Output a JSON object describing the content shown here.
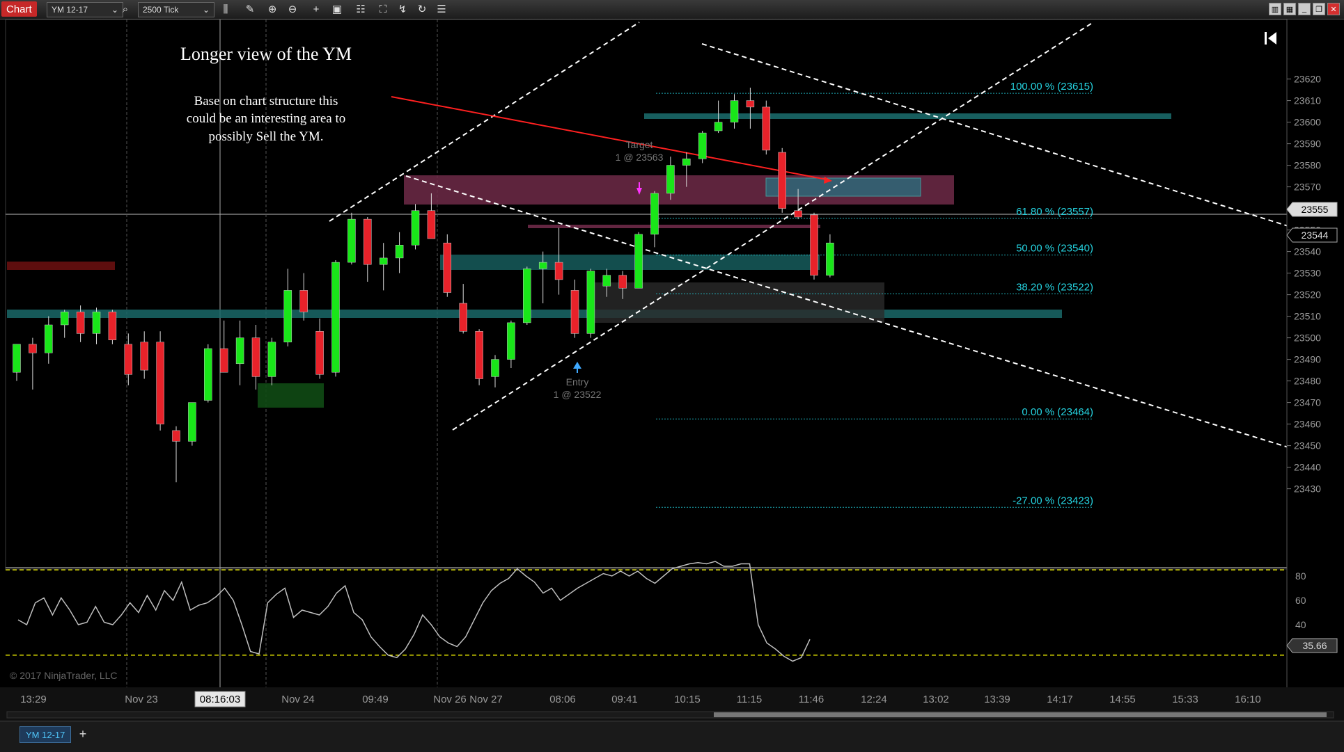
{
  "toolbar": {
    "chart_tab": "Chart",
    "instrument": "YM 12-17",
    "interval": "2500 Tick"
  },
  "annotations": {
    "title": "Longer view of the YM",
    "note_line1": "Base on chart structure this",
    "note_line2": "could be an interesting area to",
    "note_line3": "possibly Sell the YM.",
    "target_label": "Target",
    "target_detail": "1 @ 23563",
    "entry_label": "Entry",
    "entry_detail": "1 @ 23522",
    "copyright": "© 2017 NinjaTrader, LLC"
  },
  "colors": {
    "up_candle": "#19e619",
    "down_candle": "#e8222a",
    "fib": "#25d3e0",
    "level_zone": "#1a6868",
    "sell_zone": "#6e2a48",
    "trendline": "#ffffff",
    "red_line": "#ff2020",
    "oscillator": "#bfbfbf",
    "threshold": "#e6e600"
  },
  "chart_data": {
    "type": "candlestick",
    "instrument": "YM 12-17",
    "interval": "2500 Tick",
    "y_axis": {
      "ylim": [
        23423,
        23625
      ],
      "ticks": [
        23430,
        23440,
        23450,
        23460,
        23470,
        23480,
        23490,
        23500,
        23510,
        23520,
        23530,
        23540,
        23550,
        23560,
        23570,
        23580,
        23590,
        23600,
        23610,
        23620
      ]
    },
    "x_axis_labels": [
      "13:29",
      "Nov 23",
      "08:16:03",
      "Nov 24",
      "09:49",
      "Nov 26",
      "Nov 27",
      "08:06",
      "09:41",
      "10:15",
      "11:15",
      "11:46",
      "12:24",
      "13:02",
      "13:39",
      "14:17",
      "14:55",
      "15:33",
      "16:10"
    ],
    "price_markers": {
      "last": "23555",
      "current": "23544"
    },
    "candles": [
      {
        "o": 23484,
        "h": 23497,
        "l": 23480,
        "c": 23497
      },
      {
        "o": 23497,
        "h": 23500,
        "l": 23476,
        "c": 23493
      },
      {
        "o": 23493,
        "h": 23510,
        "l": 23488,
        "c": 23506
      },
      {
        "o": 23506,
        "h": 23513,
        "l": 23500,
        "c": 23512
      },
      {
        "o": 23512,
        "h": 23515,
        "l": 23498,
        "c": 23502
      },
      {
        "o": 23502,
        "h": 23514,
        "l": 23497,
        "c": 23512
      },
      {
        "o": 23512,
        "h": 23513,
        "l": 23497,
        "c": 23499
      },
      {
        "o": 23497,
        "h": 23502,
        "l": 23478,
        "c": 23483
      },
      {
        "o": 23498,
        "h": 23503,
        "l": 23481,
        "c": 23485
      },
      {
        "o": 23498,
        "h": 23503,
        "l": 23457,
        "c": 23460
      },
      {
        "o": 23457,
        "h": 23459,
        "l": 23433,
        "c": 23452
      },
      {
        "o": 23452,
        "h": 23470,
        "l": 23450,
        "c": 23470
      },
      {
        "o": 23471,
        "h": 23497,
        "l": 23470,
        "c": 23495
      },
      {
        "o": 23495,
        "h": 23508,
        "l": 23484,
        "c": 23484
      },
      {
        "o": 23488,
        "h": 23508,
        "l": 23478,
        "c": 23500
      },
      {
        "o": 23500,
        "h": 23506,
        "l": 23476,
        "c": 23482
      },
      {
        "o": 23482,
        "h": 23500,
        "l": 23478,
        "c": 23498
      },
      {
        "o": 23498,
        "h": 23532,
        "l": 23496,
        "c": 23522
      },
      {
        "o": 23522,
        "h": 23530,
        "l": 23508,
        "c": 23512
      },
      {
        "o": 23503,
        "h": 23509,
        "l": 23481,
        "c": 23483
      },
      {
        "o": 23484,
        "h": 23536,
        "l": 23482,
        "c": 23535
      },
      {
        "o": 23535,
        "h": 23558,
        "l": 23534,
        "c": 23555
      },
      {
        "o": 23555,
        "h": 23556,
        "l": 23526,
        "c": 23534
      },
      {
        "o": 23534,
        "h": 23544,
        "l": 23522,
        "c": 23537
      },
      {
        "o": 23537,
        "h": 23549,
        "l": 23530,
        "c": 23543
      },
      {
        "o": 23543,
        "h": 23562,
        "l": 23541,
        "c": 23559
      },
      {
        "o": 23559,
        "h": 23567,
        "l": 23547,
        "c": 23546
      },
      {
        "o": 23544,
        "h": 23548,
        "l": 23519,
        "c": 23521
      },
      {
        "o": 23516,
        "h": 23525,
        "l": 23502,
        "c": 23503
      },
      {
        "o": 23503,
        "h": 23504,
        "l": 23478,
        "c": 23481
      },
      {
        "o": 23482,
        "h": 23492,
        "l": 23477,
        "c": 23490
      },
      {
        "o": 23490,
        "h": 23508,
        "l": 23486,
        "c": 23507
      },
      {
        "o": 23507,
        "h": 23533,
        "l": 23506,
        "c": 23532
      },
      {
        "o": 23532,
        "h": 23540,
        "l": 23516,
        "c": 23535
      },
      {
        "o": 23535,
        "h": 23551,
        "l": 23520,
        "c": 23527
      },
      {
        "o": 23522,
        "h": 23527,
        "l": 23500,
        "c": 23502
      },
      {
        "o": 23502,
        "h": 23532,
        "l": 23500,
        "c": 23531
      },
      {
        "o": 23524,
        "h": 23532,
        "l": 23519,
        "c": 23529
      },
      {
        "o": 23529,
        "h": 23531,
        "l": 23518,
        "c": 23523
      },
      {
        "o": 23523,
        "h": 23549,
        "l": 23523,
        "c": 23548
      },
      {
        "o": 23548,
        "h": 23568,
        "l": 23542,
        "c": 23567
      },
      {
        "o": 23567,
        "h": 23584,
        "l": 23564,
        "c": 23580
      },
      {
        "o": 23580,
        "h": 23586,
        "l": 23570,
        "c": 23583
      },
      {
        "o": 23583,
        "h": 23596,
        "l": 23581,
        "c": 23595
      },
      {
        "o": 23596,
        "h": 23610,
        "l": 23595,
        "c": 23600
      },
      {
        "o": 23600,
        "h": 23613,
        "l": 23597,
        "c": 23610
      },
      {
        "o": 23610,
        "h": 23616,
        "l": 23597,
        "c": 23607
      },
      {
        "o": 23607,
        "h": 23610,
        "l": 23585,
        "c": 23587
      },
      {
        "o": 23586,
        "h": 23588,
        "l": 23558,
        "c": 23560
      },
      {
        "o": 23559,
        "h": 23569,
        "l": 23555,
        "c": 23556
      },
      {
        "o": 23557,
        "h": 23558,
        "l": 23527,
        "c": 23529
      },
      {
        "o": 23529,
        "h": 23548,
        "l": 23528,
        "c": 23544
      }
    ],
    "fibonacci": [
      {
        "label": "100.00 % (23615)",
        "price": 23615
      },
      {
        "label": "61.80 % (23557)",
        "price": 23557
      },
      {
        "label": "50.00 % (23540)",
        "price": 23540
      },
      {
        "label": "38.20 % (23522)",
        "price": 23522
      },
      {
        "label": "0.00 % (23464)",
        "price": 23464
      },
      {
        "label": "-27.00 % (23423)",
        "price": 23423
      }
    ],
    "oscillator": {
      "ticks": [
        20,
        40,
        60,
        80
      ],
      "levels": [
        85,
        15
      ],
      "current": "35.66",
      "values": [
        44,
        40,
        58,
        62,
        48,
        62,
        52,
        40,
        42,
        55,
        42,
        40,
        48,
        58,
        50,
        64,
        52,
        68,
        60,
        75,
        52,
        56,
        58,
        63,
        70,
        60,
        40,
        18,
        16,
        58,
        65,
        70,
        46,
        52,
        50,
        48,
        55,
        66,
        72,
        50,
        44,
        30,
        22,
        15,
        13,
        20,
        32,
        48,
        40,
        30,
        25,
        22,
        30,
        44,
        58,
        68,
        74,
        78,
        86,
        80,
        75,
        66,
        70,
        60,
        65,
        70,
        74,
        78,
        82,
        80,
        84,
        80,
        84,
        78,
        74,
        80,
        86,
        88,
        90,
        91,
        90,
        92,
        88,
        88,
        90,
        90,
        40,
        25,
        20,
        14,
        10,
        13,
        28
      ]
    }
  }
}
